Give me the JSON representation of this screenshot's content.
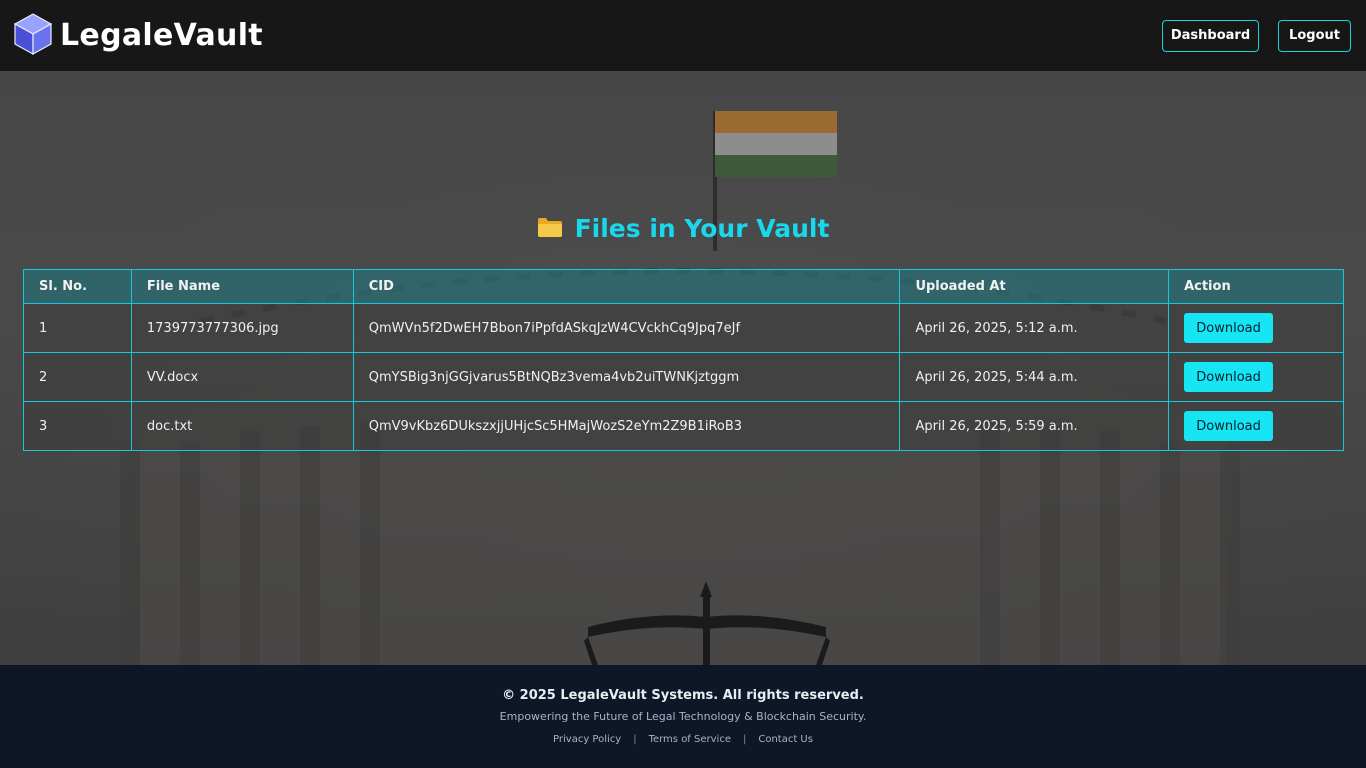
{
  "header": {
    "brand": "LegaleVault",
    "nav": {
      "dashboard": "Dashboard",
      "logout": "Logout"
    }
  },
  "main": {
    "title": "Files in Your Vault",
    "title_icon": "folder-icon",
    "table": {
      "columns": [
        "Sl. No.",
        "File Name",
        "CID",
        "Uploaded At",
        "Action"
      ],
      "rows": [
        {
          "sl": "1",
          "name": "1739773777306.jpg",
          "cid": "QmWVn5f2DwEH7Bbon7iPpfdASkqJzW4CVckhCq9Jpq7eJf",
          "uploaded": "April 26, 2025, 5:12 a.m.",
          "action": "Download"
        },
        {
          "sl": "2",
          "name": "VV.docx",
          "cid": "QmYSBig3njGGjvarus5BtNQBz3vema4vb2uiTWNKjztggm",
          "uploaded": "April 26, 2025, 5:44 a.m.",
          "action": "Download"
        },
        {
          "sl": "3",
          "name": "doc.txt",
          "cid": "QmV9vKbz6DUkszxjjUHjcSc5HMajWozS2eYm2Z9B1iRoB3",
          "uploaded": "April 26, 2025, 5:59 a.m.",
          "action": "Download"
        }
      ]
    }
  },
  "footer": {
    "copyright": "© 2025 LegaleVault Systems. All rights reserved.",
    "tagline": "Empowering the Future of Legal Technology & Blockchain Security.",
    "links": [
      "Privacy Policy",
      "Terms of Service",
      "Contact Us"
    ],
    "separator": "|"
  },
  "colors": {
    "accent": "#19d8ee",
    "button": "#16e6f4",
    "header_bg": "#171717",
    "footer_bg": "#0e1727"
  }
}
